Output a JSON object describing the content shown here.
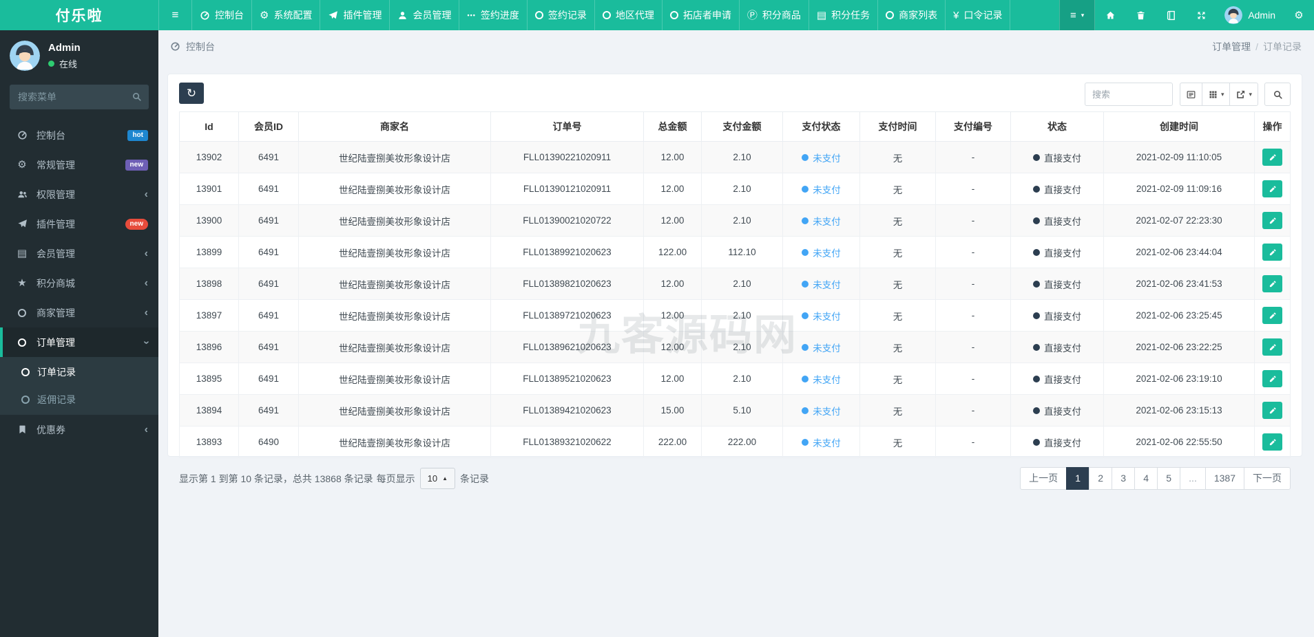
{
  "brand": "付乐啦",
  "navbar": {
    "items": [
      {
        "label": "控制台",
        "icon": "gauge-icon"
      },
      {
        "label": "系统配置",
        "icon": "gear-icon"
      },
      {
        "label": "插件管理",
        "icon": "paper-plane-icon"
      },
      {
        "label": "会员管理",
        "icon": "user-icon"
      },
      {
        "label": "签约进度",
        "icon": "ellipsis-icon"
      },
      {
        "label": "签约记录",
        "icon": "circle-icon"
      },
      {
        "label": "地区代理",
        "icon": "circle-icon"
      },
      {
        "label": "拓店者申请",
        "icon": "circle-icon"
      },
      {
        "label": "积分商品",
        "icon": "p-circle-icon"
      },
      {
        "label": "积分任务",
        "icon": "tasks-icon"
      },
      {
        "label": "商家列表",
        "icon": "circle-icon"
      },
      {
        "label": "口令记录",
        "icon": "yen-icon"
      }
    ],
    "user_name": "Admin"
  },
  "sidebar": {
    "user_name": "Admin",
    "user_status": "在线",
    "online_dot_color": "#2ecc71",
    "search_placeholder": "搜索菜单",
    "items": [
      {
        "label": "控制台",
        "icon": "gauge-icon",
        "badge": "hot",
        "badge_color": "#1e87d0"
      },
      {
        "label": "常规管理",
        "icon": "gears-icon",
        "badge": "new",
        "badge_color": "#6e5fb5"
      },
      {
        "label": "权限管理",
        "icon": "users-icon",
        "chevron": "left"
      },
      {
        "label": "插件管理",
        "icon": "paper-plane-icon",
        "badge": "new",
        "badge_color": "#e74c3c",
        "badge_pill": true
      },
      {
        "label": "会员管理",
        "icon": "list-icon",
        "chevron": "left"
      },
      {
        "label": "积分商城",
        "icon": "star-icon",
        "chevron": "left"
      },
      {
        "label": "商家管理",
        "icon": "circle-icon",
        "chevron": "left"
      },
      {
        "label": "订单管理",
        "icon": "circle-icon",
        "chevron": "down",
        "active": true,
        "children": [
          {
            "label": "订单记录",
            "icon": "circle-icon",
            "active": true
          },
          {
            "label": "返佣记录",
            "icon": "circle-icon"
          }
        ]
      },
      {
        "label": "优惠券",
        "icon": "bookmark-icon",
        "chevron": "left"
      }
    ]
  },
  "breadcrumb": {
    "page": "控制台",
    "trail": [
      "订单管理",
      "订单记录"
    ]
  },
  "toolbar": {
    "search_placeholder": "搜索"
  },
  "table": {
    "columns": [
      "Id",
      "会员ID",
      "商家名",
      "订单号",
      "总金额",
      "支付金额",
      "支付状态",
      "支付时间",
      "支付编号",
      "状态",
      "创建时间",
      "操作"
    ],
    "rows": [
      {
        "id": "13902",
        "member_id": "6491",
        "shop": "世纪陆壹捌美妆形象设计店",
        "order_no": "FLL01390221020911",
        "total": "12.00",
        "paid": "2.10",
        "pay_status": "未支付",
        "pay_time": "无",
        "pay_no": "-",
        "status": "直接支付",
        "created": "2021-02-09 11:10:05"
      },
      {
        "id": "13901",
        "member_id": "6491",
        "shop": "世纪陆壹捌美妆形象设计店",
        "order_no": "FLL01390121020911",
        "total": "12.00",
        "paid": "2.10",
        "pay_status": "未支付",
        "pay_time": "无",
        "pay_no": "-",
        "status": "直接支付",
        "created": "2021-02-09 11:09:16"
      },
      {
        "id": "13900",
        "member_id": "6491",
        "shop": "世纪陆壹捌美妆形象设计店",
        "order_no": "FLL01390021020722",
        "total": "12.00",
        "paid": "2.10",
        "pay_status": "未支付",
        "pay_time": "无",
        "pay_no": "-",
        "status": "直接支付",
        "created": "2021-02-07 22:23:30"
      },
      {
        "id": "13899",
        "member_id": "6491",
        "shop": "世纪陆壹捌美妆形象设计店",
        "order_no": "FLL01389921020623",
        "total": "122.00",
        "paid": "112.10",
        "pay_status": "未支付",
        "pay_time": "无",
        "pay_no": "-",
        "status": "直接支付",
        "created": "2021-02-06 23:44:04"
      },
      {
        "id": "13898",
        "member_id": "6491",
        "shop": "世纪陆壹捌美妆形象设计店",
        "order_no": "FLL01389821020623",
        "total": "12.00",
        "paid": "2.10",
        "pay_status": "未支付",
        "pay_time": "无",
        "pay_no": "-",
        "status": "直接支付",
        "created": "2021-02-06 23:41:53"
      },
      {
        "id": "13897",
        "member_id": "6491",
        "shop": "世纪陆壹捌美妆形象设计店",
        "order_no": "FLL01389721020623",
        "total": "12.00",
        "paid": "2.10",
        "pay_status": "未支付",
        "pay_time": "无",
        "pay_no": "-",
        "status": "直接支付",
        "created": "2021-02-06 23:25:45"
      },
      {
        "id": "13896",
        "member_id": "6491",
        "shop": "世纪陆壹捌美妆形象设计店",
        "order_no": "FLL01389621020623",
        "total": "12.00",
        "paid": "2.10",
        "pay_status": "未支付",
        "pay_time": "无",
        "pay_no": "-",
        "status": "直接支付",
        "created": "2021-02-06 23:22:25"
      },
      {
        "id": "13895",
        "member_id": "6491",
        "shop": "世纪陆壹捌美妆形象设计店",
        "order_no": "FLL01389521020623",
        "total": "12.00",
        "paid": "2.10",
        "pay_status": "未支付",
        "pay_time": "无",
        "pay_no": "-",
        "status": "直接支付",
        "created": "2021-02-06 23:19:10"
      },
      {
        "id": "13894",
        "member_id": "6491",
        "shop": "世纪陆壹捌美妆形象设计店",
        "order_no": "FLL01389421020623",
        "total": "15.00",
        "paid": "5.10",
        "pay_status": "未支付",
        "pay_time": "无",
        "pay_no": "-",
        "status": "直接支付",
        "created": "2021-02-06 23:15:13"
      },
      {
        "id": "13893",
        "member_id": "6490",
        "shop": "世纪陆壹捌美妆形象设计店",
        "order_no": "FLL01389321020622",
        "total": "222.00",
        "paid": "222.00",
        "pay_status": "未支付",
        "pay_time": "无",
        "pay_no": "-",
        "status": "直接支付",
        "created": "2021-02-06 22:55:50"
      }
    ],
    "pay_status_color": "#42a5f5",
    "status_dot_color": "#2c3e50"
  },
  "footer": {
    "showing_text": "显示第 1 到第 10 条记录，总共 13868 条记录",
    "per_page_prefix": "每页显示",
    "page_size": "10",
    "per_page_suffix": "条记录",
    "pages": [
      "上一页",
      "1",
      "2",
      "3",
      "4",
      "5",
      "...",
      "1387",
      "下一页"
    ],
    "active_page": "1"
  },
  "watermark": "九客源码网"
}
